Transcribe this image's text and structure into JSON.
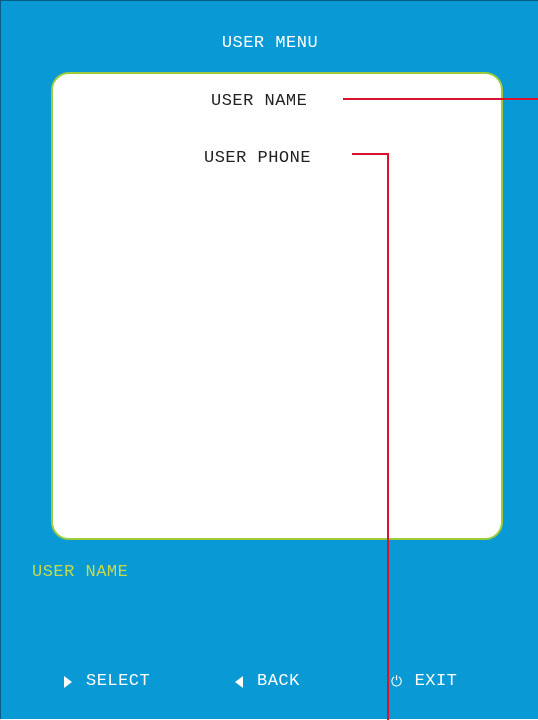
{
  "header": {
    "title": "USER MENU"
  },
  "menu": {
    "items": [
      {
        "label": "USER NAME"
      },
      {
        "label": "USER PHONE"
      }
    ]
  },
  "status": {
    "text": "USER NAME"
  },
  "softkeys": {
    "select": {
      "label": "SELECT",
      "icon": "triangle-right-icon"
    },
    "back": {
      "label": "BACK",
      "icon": "triangle-left-icon"
    },
    "exit": {
      "label": "EXIT",
      "icon": "power-icon"
    }
  },
  "colors": {
    "screen_background": "#099ad6",
    "panel_border": "#9ccc3c",
    "status_text": "#c6d94a",
    "callout_line": "#d9122d"
  }
}
